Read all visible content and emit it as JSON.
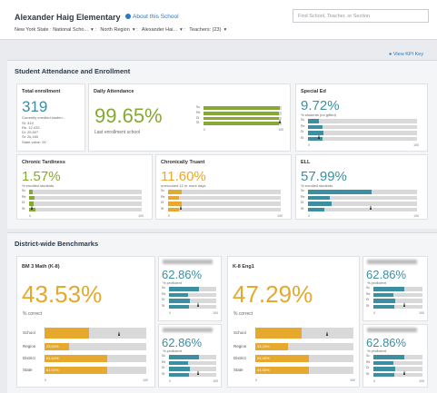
{
  "header": {
    "school_name": "Alexander Haig Elementary",
    "about_link": "About this School",
    "search_placeholder": "Find School, Teacher, or Section",
    "filters": [
      "New York State : National Scho...",
      "North Region",
      "Alexander Hai...",
      "Teachers: (23)"
    ],
    "kpi_link": "View KPI Key"
  },
  "attendance": {
    "title": "Student Attendance and Enrollment",
    "total_enrollment": {
      "label": "Total enrollment",
      "value": "319",
      "sub": "Currently enrolled studen...",
      "details": [
        "St: 319",
        "Re: 12,433",
        "Di: 25,507",
        "St: 2k,160"
      ],
      "state_value": "State value: 00"
    },
    "daily_attendance": {
      "label": "Daily Attendance",
      "value": "99.65%",
      "sub": "Last enrollment school",
      "fraction": 0.98
    },
    "special_ed": {
      "label": "Special Ed",
      "value": "9.72%",
      "sub": "% students (no gifted)",
      "fraction": 0.1
    },
    "chronic_tardiness": {
      "label": "Chronic Tardiness",
      "value": "1.57%",
      "sub": "% enrolled students",
      "fraction": 0.03
    },
    "chronic_truant": {
      "label": "Chronically Truant",
      "value": "11.60%",
      "sub": "unexcused 12 or more days",
      "fraction": 0.12
    },
    "ell": {
      "label": "ELL",
      "value": "57.99%",
      "sub": "% enrolled students",
      "fraction": 0.58
    },
    "axis_min": "0",
    "axis_max": "100",
    "row_labels": [
      "Sc",
      "Re",
      "Di",
      "St"
    ]
  },
  "benchmarks": {
    "title": "District-wide Benchmarks",
    "math": {
      "label": "BM 3 Math (K-8)",
      "value": "43.53%",
      "sub": "% correct",
      "rows": [
        {
          "label": "School",
          "value": "",
          "fraction": 0.44
        },
        {
          "label": "Region",
          "value": "23.53%",
          "fraction": 0.24
        },
        {
          "label": "District",
          "value": "61.64%",
          "fraction": 0.62
        },
        {
          "label": "State",
          "value": "61.94%",
          "fraction": 0.62
        }
      ]
    },
    "eng": {
      "label": "K-8 Eng1",
      "value": "47.29%",
      "sub": "% correct",
      "rows": [
        {
          "label": "School",
          "value": "",
          "fraction": 0.47
        },
        {
          "label": "Region",
          "value": "33.33%",
          "fraction": 0.33
        },
        {
          "label": "District",
          "value": "54.55%",
          "fraction": 0.55
        },
        {
          "label": "State",
          "value": "54.55%",
          "fraction": 0.55
        }
      ]
    },
    "mini_value": "62.86%",
    "mini_sub": "% proficient",
    "axis_min": "0",
    "axis_max": "100"
  },
  "colors": {
    "teal": "#3b8fa0",
    "orange": "#e6a82d",
    "green": "#86a935"
  }
}
